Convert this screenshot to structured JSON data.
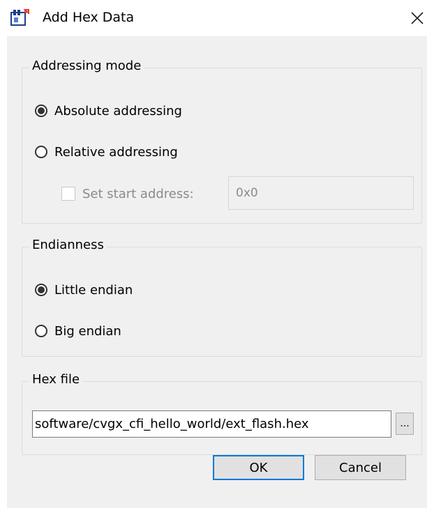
{
  "window": {
    "title": "Add Hex Data",
    "close_glyph": "✕"
  },
  "addressing": {
    "legend": "Addressing mode",
    "options": [
      {
        "label": "Absolute addressing",
        "selected": true
      },
      {
        "label": "Relative addressing",
        "selected": false
      }
    ],
    "start_address": {
      "label": "Set start address:",
      "checked": false,
      "value": "0x0"
    }
  },
  "endianness": {
    "legend": "Endianness",
    "options": [
      {
        "label": "Little endian",
        "selected": true
      },
      {
        "label": "Big endian",
        "selected": false
      }
    ]
  },
  "hex_file": {
    "legend": "Hex file",
    "path": "software/cvgx_cfi_hello_world/ext_flash.hex",
    "browse_label": "..."
  },
  "buttons": {
    "ok": "OK",
    "cancel": "Cancel"
  },
  "colors": {
    "accent": "#0078d7",
    "dialog_bg": "#f0f0f0"
  }
}
